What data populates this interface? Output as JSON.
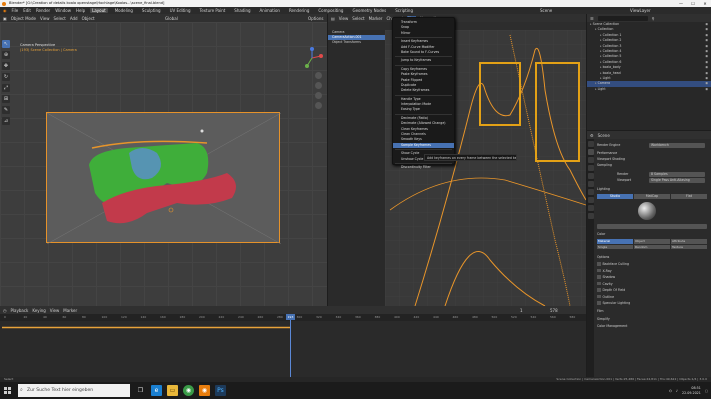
{
  "window": {
    "title": "Blender* [G:\\Creation of details koala openstage\\Hochlage\\Koalas...\\scene_final.blend]",
    "controls": [
      "—",
      "☐",
      "✕"
    ]
  },
  "menubar": {
    "menus": [
      "File",
      "Edit",
      "Render",
      "Window",
      "Help"
    ],
    "workspaces": [
      "Layout",
      "Modeling",
      "Sculpting",
      "UV Editing",
      "Texture Paint",
      "Shading",
      "Animation",
      "Rendering",
      "Compositing",
      "Geometry Nodes",
      "Scripting"
    ],
    "active_workspace": "Layout",
    "scene_label": "Scene",
    "view_layer_label": "ViewLayer"
  },
  "viewport": {
    "header": [
      "Object Mode",
      "View",
      "Select",
      "Add",
      "Object"
    ],
    "global_label": "Global",
    "options_label": "Options",
    "camera_info": [
      "Camera Perspective",
      "(193) Scene Collection | Camera"
    ]
  },
  "graph_editor": {
    "header": [
      "View",
      "Select",
      "Marker",
      "Channel",
      "Key"
    ],
    "normalize_label": "Normalize",
    "channels": [
      {
        "label": "Camera",
        "selected": false
      },
      {
        "label": "CameraAction.001",
        "selected": true
      },
      {
        "label": "Object Transforms",
        "selected": false
      }
    ],
    "context_menu": {
      "items": [
        "Transform",
        "Snap",
        "Mirror",
        "",
        "Insert Keyframes",
        "Add F-Curve Modifier",
        "Bake Sound to F-Curves",
        "",
        "Jump to Keyframes",
        "",
        "Copy Keyframes",
        "Paste Keyframes",
        "Paste Flipped",
        "Duplicate",
        "Delete Keyframes",
        "",
        "Handle Type",
        "Interpolation Mode",
        "Easing Type",
        "",
        "Decimate (Ratio)",
        "Decimate (Allowed Change)",
        "Clean Keyframes",
        "Clean Channels",
        "Smooth Keys",
        "Sample Keyframes",
        "",
        "Show Cycle",
        "Unshow Cycle",
        "",
        "Discontinuity Filter"
      ],
      "highlighted": "Sample Keyframes"
    },
    "tooltip": "Add keyframes on every frame between the selected keyframes"
  },
  "outliner": {
    "search_placeholder": "",
    "rows": [
      {
        "label": "Scene Collection",
        "indent": 0,
        "selected": false
      },
      {
        "label": "Collection",
        "indent": 1,
        "selected": false
      },
      {
        "label": "Collection 1",
        "indent": 2,
        "selected": false
      },
      {
        "label": "Collection 2",
        "indent": 2,
        "selected": false
      },
      {
        "label": "Collection 3",
        "indent": 2,
        "selected": false
      },
      {
        "label": "Collection 4",
        "indent": 2,
        "selected": false
      },
      {
        "label": "Collection 5",
        "indent": 2,
        "selected": false
      },
      {
        "label": "Collection 6",
        "indent": 2,
        "selected": false
      },
      {
        "label": "koala_body",
        "indent": 2,
        "selected": false
      },
      {
        "label": "koala_head",
        "indent": 2,
        "selected": false
      },
      {
        "label": "Light",
        "indent": 2,
        "selected": false
      },
      {
        "label": "Camera",
        "indent": 1,
        "selected": true
      },
      {
        "label": "Light",
        "indent": 1,
        "selected": false
      }
    ]
  },
  "properties": {
    "object_label": "Scene",
    "rows": [
      {
        "label": "Render Engine",
        "value": "Workbench"
      },
      {
        "label": "Performance",
        "value": ""
      },
      {
        "label": "Viewport Shading",
        "value": ""
      },
      {
        "label": "Sampling",
        "value": ""
      },
      {
        "label": "Render",
        "value": "8 Samples"
      },
      {
        "label": "Viewport",
        "value": "Single Pass Anti-Aliasing"
      }
    ],
    "lighting": {
      "title": "Lighting",
      "modes": [
        "Studio",
        "MatCap",
        "Flat"
      ],
      "active_mode": "Studio"
    },
    "color": {
      "title": "Color",
      "options": [
        "Material",
        "Object",
        "Attribute",
        "Single",
        "Random",
        "Texture"
      ],
      "active": "Material"
    },
    "options": {
      "title": "Options",
      "items": [
        "Backface Culling",
        "X-Ray",
        "Shadow",
        "Cavity",
        "Depth Of Field",
        "Outline",
        "Specular Lighting"
      ]
    },
    "sections": [
      "Film",
      "Simplify",
      "Color Management"
    ]
  },
  "timeline": {
    "header": [
      "Playback",
      "Keying",
      "View",
      "Marker"
    ],
    "ticks": [
      "0",
      "20",
      "40",
      "60",
      "80",
      "100",
      "120",
      "140",
      "160",
      "180",
      "200",
      "220",
      "240",
      "260",
      "280",
      "300",
      "320",
      "340",
      "360",
      "380",
      "400",
      "420",
      "440",
      "460",
      "480",
      "500",
      "520",
      "540",
      "560",
      "580"
    ],
    "current_frame": "193",
    "frame_range": [
      "1",
      "578"
    ]
  },
  "statusbar": {
    "left": "Select",
    "right": "Scene Collection | CameraAction.001 | Verts:25,486 | Faces:24,811 | Tris:49,622 | Objects:1/4 | 3.0.0"
  },
  "taskbar": {
    "search_placeholder": "Zur Suche Text hier eingeben",
    "time": "08:51",
    "date": "22.09.2021"
  },
  "colors": {
    "accent": "#4772b3",
    "curve": "#e8952a",
    "highlight_box": "#e3a116"
  }
}
